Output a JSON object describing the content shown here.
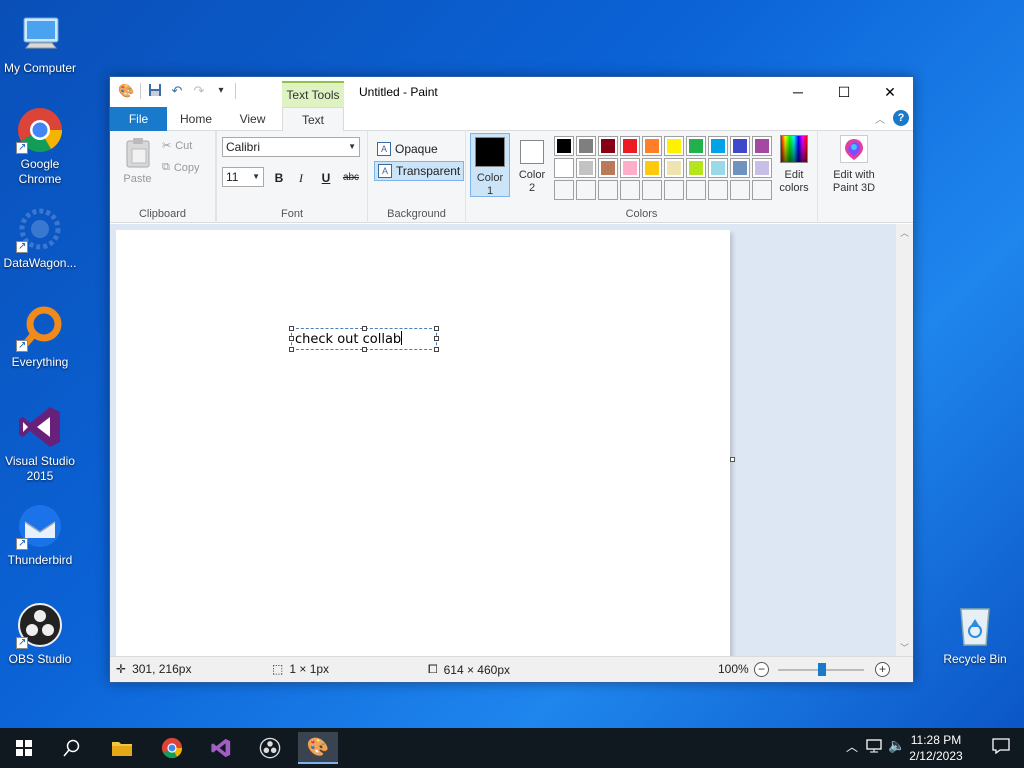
{
  "desktop": {
    "icons": [
      {
        "label": "My Computer"
      },
      {
        "label": "Google Chrome"
      },
      {
        "label": "DataWagon..."
      },
      {
        "label": "Everything"
      },
      {
        "label": "Visual Studio 2015"
      },
      {
        "label": "Thunderbird"
      },
      {
        "label": "OBS Studio"
      },
      {
        "label": "Recycle Bin"
      }
    ]
  },
  "window": {
    "title": "Untitled - Paint",
    "context_tab": "Text Tools",
    "tabs": {
      "file": "File",
      "home": "Home",
      "view": "View",
      "text": "Text"
    },
    "help": "?"
  },
  "ribbon": {
    "clipboard": {
      "label": "Clipboard",
      "paste": "Paste",
      "cut": "Cut",
      "copy": "Copy"
    },
    "font": {
      "label": "Font",
      "family": "Calibri",
      "size": "11",
      "bold": "B",
      "italic": "I",
      "underline": "U",
      "strike": "abc"
    },
    "background": {
      "label": "Background",
      "opaque": "Opaque",
      "transparent": "Transparent",
      "selected": "Transparent"
    },
    "colors": {
      "label": "Colors",
      "color1_label": "Color 1",
      "color2_label": "Color 2",
      "color1": "#000000",
      "color2": "#ffffff",
      "edit_colors": "Edit colors",
      "edit_paint3d": "Edit with Paint 3D",
      "palette_row1": [
        "#000000",
        "#7f7f7f",
        "#880015",
        "#ed1c24",
        "#ff7f27",
        "#fff200",
        "#22b14c",
        "#00a2e8",
        "#3f48cc",
        "#a349a4"
      ],
      "palette_row2": [
        "#ffffff",
        "#c3c3c3",
        "#b97a57",
        "#ffaec9",
        "#ffc90e",
        "#efe4b0",
        "#b5e61d",
        "#99d9ea",
        "#7092be",
        "#c8bfe7"
      ]
    }
  },
  "canvas": {
    "text": "check out collab"
  },
  "status": {
    "cursor": "301, 216px",
    "selection": "1 × 1px",
    "size": "614 × 460px",
    "zoom": "100%"
  },
  "taskbar": {
    "time": "11:28 PM",
    "date": "2/12/2023"
  }
}
